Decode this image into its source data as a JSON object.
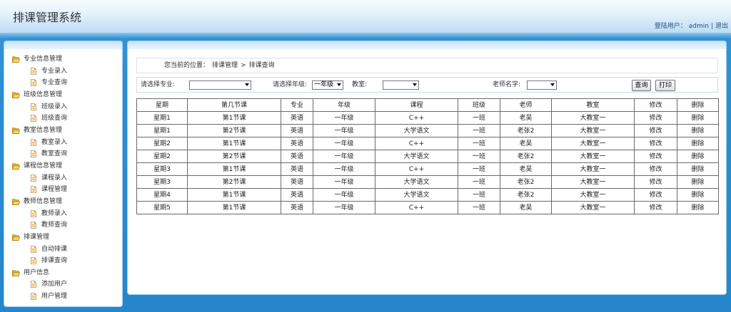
{
  "app": {
    "title": "排课管理系统"
  },
  "user_bar": {
    "label": "登陆用户：",
    "username": "admin",
    "separator": "|",
    "logout": "退出"
  },
  "sidebar": {
    "groups": [
      {
        "label": "专业信息管理",
        "items": [
          "专业录入",
          "专业查询"
        ]
      },
      {
        "label": "班级信息管理",
        "items": [
          "班级录入",
          "班级查询"
        ]
      },
      {
        "label": "教室信息管理",
        "items": [
          "教室录入",
          "教室查询"
        ]
      },
      {
        "label": "课程信息管理",
        "items": [
          "课程录入",
          "课程管理"
        ]
      },
      {
        "label": "教师信息管理",
        "items": [
          "教师录入",
          "教师查询"
        ]
      },
      {
        "label": "排课管理",
        "items": [
          "自动排课",
          "排课查询"
        ]
      },
      {
        "label": "用户信息",
        "items": [
          "添加用户",
          "用户管理"
        ]
      }
    ]
  },
  "breadcrumb": {
    "prefix": "您当前的位置：",
    "parent": "排课管理",
    "separator": ">",
    "current": "排课查询"
  },
  "filters": {
    "major": {
      "label": "请选择专业:",
      "value": ""
    },
    "grade": {
      "label": "请选择年级:",
      "value": "一年级"
    },
    "classroom": {
      "label": "教室:",
      "value": ""
    },
    "teacher": {
      "label": "老师名字:",
      "value": ""
    },
    "search_button": "查询",
    "print_button": "打印"
  },
  "table": {
    "columns": [
      "星期",
      "第几节课",
      "专业",
      "年级",
      "课程",
      "班级",
      "老师",
      "教室",
      "修改",
      "删除"
    ],
    "rows": [
      [
        "星期1",
        "第1节课",
        "英语",
        "一年级",
        "C++",
        "一班",
        "老吴",
        "大教室一"
      ],
      [
        "星期1",
        "第2节课",
        "英语",
        "一年级",
        "大学语文",
        "一班",
        "老张2",
        "大教室一"
      ],
      [
        "星期2",
        "第1节课",
        "英语",
        "一年级",
        "C++",
        "一班",
        "老吴",
        "大教室一"
      ],
      [
        "星期2",
        "第2节课",
        "英语",
        "一年级",
        "大学语文",
        "一班",
        "老张2",
        "大教室一"
      ],
      [
        "星期3",
        "第1节课",
        "英语",
        "一年级",
        "C++",
        "一班",
        "老吴",
        "大教室一"
      ],
      [
        "星期3",
        "第2节课",
        "英语",
        "一年级",
        "大学语文",
        "一班",
        "老张2",
        "大教室一"
      ],
      [
        "星期4",
        "第1节课",
        "英语",
        "一年级",
        "大学语文",
        "一班",
        "老张2",
        "大教室一"
      ],
      [
        "星期5",
        "第1节课",
        "英语",
        "一年级",
        "C++",
        "一班",
        "老吴",
        "大教室一"
      ]
    ],
    "edit_label": "修改",
    "delete_label": "删除"
  },
  "icons": {
    "sidebar_group": "folder-open-icon",
    "sidebar_item": "document-icon",
    "select_arrow": "dropdown-arrow-icon"
  },
  "colors": {
    "header_top": "#f8fcff",
    "header_bottom": "#bcdcf3",
    "page_background": "#2c8dd1",
    "panel_background": "#ffffff",
    "panel_border": "#9fd0f0",
    "table_border": "#6a6a6a",
    "text": "#333333"
  }
}
